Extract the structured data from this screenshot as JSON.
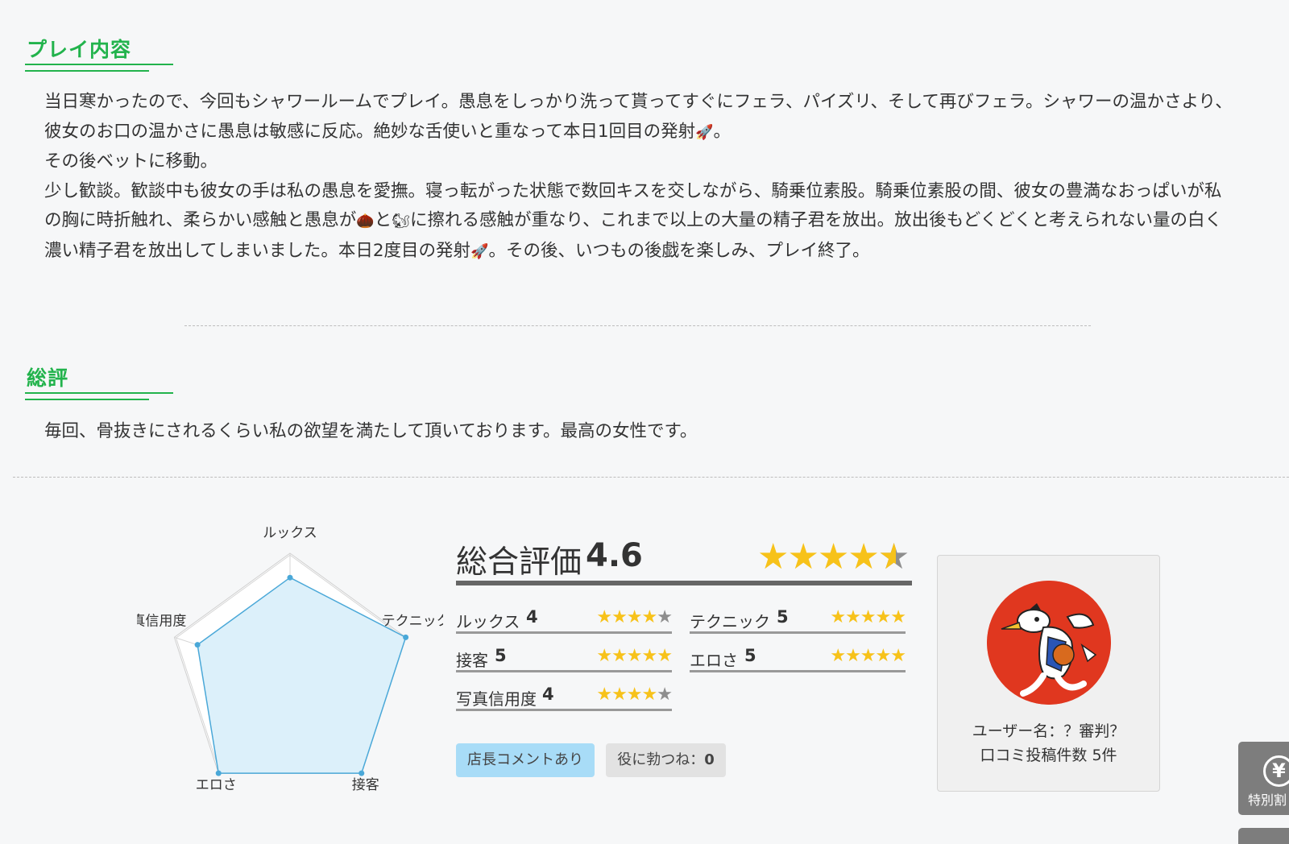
{
  "play_section": {
    "title": "プレイ内容",
    "paragraphs": [
      {
        "before": "当日寒かったので、今回もシャワールームでプレイ。愚息をしっかり洗って貰ってすぐにフェラ、パイズリ、そして再びフェラ。シャワーの温かさより、彼女のお口の温かさに愚息は敏感に反応。絶妙な舌使いと重なって本日1回目の発射",
        "emoji": "🚀",
        "after": "。"
      },
      {
        "text": "その後ベットに移動。"
      },
      {
        "part1": "少し歓談。歓談中も彼女の手は私の愚息を愛撫。寝っ転がった状態で数回キスを交しながら、騎乗位素股。騎乗位素股の間、彼女の豊満なおっぱいが私の胸に時折触れ、柔らかい感触と愚息が",
        "emoji1": "🌰",
        "part2": "と",
        "emoji2": "🐿",
        "part3": "に擦れる感触が重なり、これまで以上の大量の精子君を放出。放出後もどくどくと考えられない量の白く濃い精子君を放出してしまいました。本日2度目の発射",
        "emoji3": "🚀",
        "part4": "。その後、いつもの後戯を楽しみ、プレイ終了。"
      }
    ]
  },
  "summary_section": {
    "title": "総評",
    "text": "毎回、骨抜きにされるくらい私の欲望を満たして頂いております。最高の女性です。"
  },
  "radar": {
    "labels": [
      "ルックス",
      "テクニック",
      "接客",
      "エロさ",
      "写真信用度"
    ],
    "values": [
      4,
      5,
      5,
      5,
      4
    ],
    "max": 5,
    "fill_color": "#dcf0fa",
    "stroke_color": "#4aa8d8"
  },
  "overall": {
    "label": "総合評価",
    "score": "4.6",
    "score_value": 4.6,
    "star_count": 5
  },
  "ratings": [
    {
      "label": "ルックス",
      "value": "4",
      "stars": 4
    },
    {
      "label": "テクニック",
      "value": "5",
      "stars": 5
    },
    {
      "label": "接客",
      "value": "5",
      "stars": 5
    },
    {
      "label": "エロさ",
      "value": "5",
      "stars": 5
    },
    {
      "label": "写真信用度",
      "value": "4",
      "stars": 4
    }
  ],
  "buttons": {
    "manager_comment": "店長コメントあり",
    "helpful_label": "役に勃つね：",
    "helpful_count": "0"
  },
  "user": {
    "name": "ユーザー名：？審判？",
    "posts": "口コミ投稿件数 5件",
    "avatar_icon": "referee-mascot-icon"
  },
  "side_tab": {
    "icon": "yen-icon",
    "icon_glyph": "¥",
    "label": "特別割"
  },
  "colors": {
    "accent_green": "#22b34c",
    "star_gold": "#f7c21a",
    "star_gray": "#8e8e8e",
    "comment_button": "#a8dcf7"
  }
}
